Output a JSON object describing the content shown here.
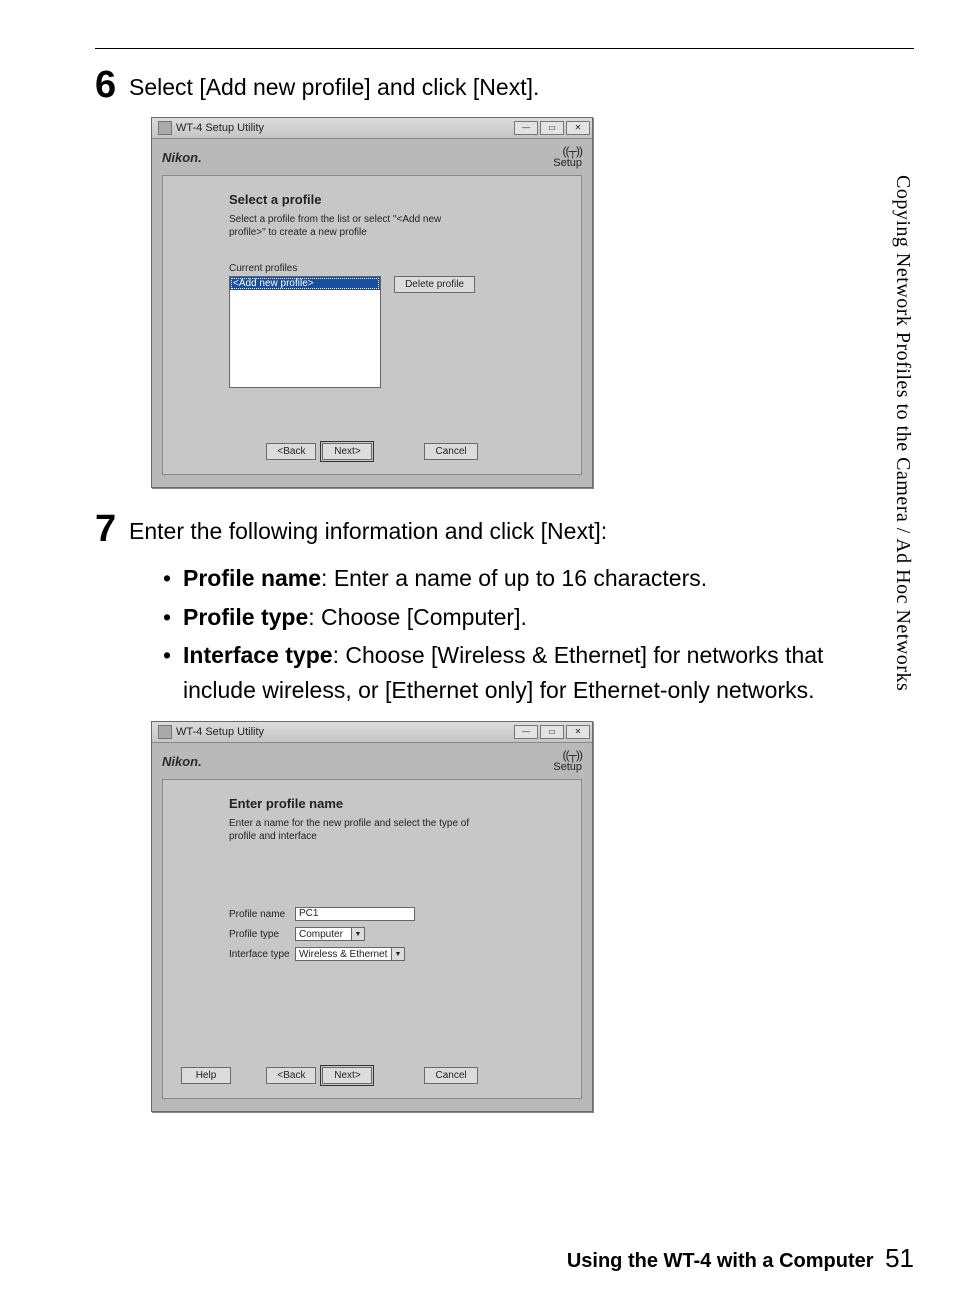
{
  "sideLabel": "Copying Network Profiles to the Camera / Ad Hoc Networks",
  "step6": {
    "num": "6",
    "text": "Select [Add new profile] and click [Next]."
  },
  "step7": {
    "num": "7",
    "text": "Enter the following information and click [Next]:",
    "bullets": {
      "b1_label": "Profile name",
      "b1_text": ": Enter a name of up to 16 characters.",
      "b2_label": "Profile type",
      "b2_text": ": Choose [Computer].",
      "b3_label": "Interface type",
      "b3_text": ": Choose [Wireless & Ethernet] for networks that include wireless, or [Ethernet only] for Ethernet-only networks."
    }
  },
  "dialog1": {
    "title": "WT-4 Setup Utility",
    "brand": "Nikon.",
    "setupLabel": "Setup",
    "heading": "Select a profile",
    "desc": "Select a profile from the list or select \"<Add new profile>\" to create a new profile",
    "currentProfilesLabel": "Current profiles",
    "listSelected": "<Add new profile>",
    "deleteBtn": "Delete profile",
    "back": "<Back",
    "next": "Next>",
    "cancel": "Cancel"
  },
  "dialog2": {
    "title": "WT-4 Setup Utility",
    "brand": "Nikon.",
    "setupLabel": "Setup",
    "heading": "Enter profile name",
    "desc": "Enter a name for the new profile and select the type of profile and interface",
    "profileNameLabel": "Profile name",
    "profileNameValue": "PC1",
    "profileTypeLabel": "Profile type",
    "profileTypeValue": "Computer",
    "interfaceTypeLabel": "Interface type",
    "interfaceTypeValue": "Wireless & Ethernet",
    "help": "Help",
    "back": "<Back",
    "next": "Next>",
    "cancel": "Cancel"
  },
  "footer": {
    "text": "Using the WT-4 with a Computer",
    "page": "51"
  }
}
